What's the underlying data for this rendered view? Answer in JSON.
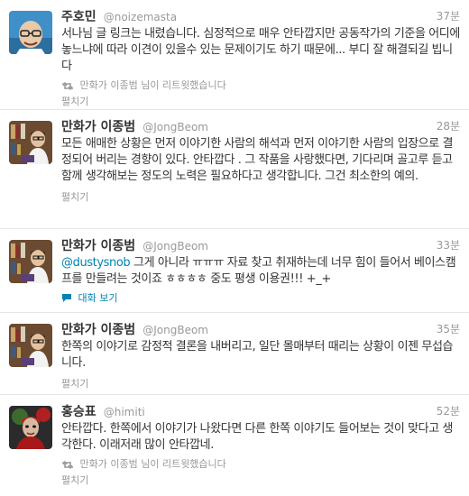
{
  "tweets": [
    {
      "fullname": "주호민",
      "username": "@noizemasta",
      "time": "37분",
      "text": "서나님 글 링크는 내렸습니다. 심정적으로 매우 안타깝지만 공동작가의 기준을 어디에 놓느냐에 따라 이견이 있을수 있는 문제이기도 하기 때문에... 부디 잘 해결되길 빕니다",
      "retweet_note": "만화가 이종범 님이 리트윗했습니다",
      "action": "펼치기",
      "avatar_icon": "avatar-glasses-man-icon"
    },
    {
      "fullname": "만화가 이종범",
      "username": "@JongBeom",
      "time": "28분",
      "text": "모든 애매한 상황은 먼저 이야기한 사람의 해석과 먼저 이야기한 사람의 입장으로 결정되어 버리는 경향이 있다. 안타깝다 . 그 작품을 사랑했다면, 기다리며 골고루 듣고 함께 생각해보는 정도의 노력은 필요하다고 생각합니다. 그건 최소한의 예의.",
      "action": "펼치기",
      "avatar_icon": "avatar-bookshelf-icon"
    },
    {
      "fullname": "만화가 이종범",
      "username": "@JongBeom",
      "time": "33분",
      "mention": "@dustysnob",
      "text": " 그게 아니라 ㅠㅠㅠ 자료 찾고 취재하는데 너무 힘이 들어서 베이스캠프를 만들려는 것이죠 ㅎㅎㅎㅎ 중도 평생 이용권!!! +_+",
      "conversation_label": "대화 보기",
      "avatar_icon": "avatar-bookshelf-icon"
    },
    {
      "fullname": "만화가 이종범",
      "username": "@JongBeom",
      "time": "35분",
      "text": "한쪽의 이야기로 감정적 결론을 내버리고, 일단 몰매부터 때리는 상황이 이젠 무섭습니다.",
      "action": "펼치기",
      "avatar_icon": "avatar-bookshelf-icon"
    },
    {
      "fullname": "홍승표",
      "username": "@himiti",
      "time": "52분",
      "text": "안타깝다. 한쪽에서 이야기가 나왔다면 다른 한쪽 이야기도 들어보는 것이 맞다고 생각한다. 이래저래 많이 안타깝네.",
      "retweet_note": "만화가 이종범 님이 리트윗했습니다",
      "action": "펼치기",
      "avatar_icon": "avatar-red-figure-icon"
    }
  ],
  "colors": {
    "link": "#0084b4",
    "muted": "#999999",
    "text": "#333333",
    "divider": "#e6e6e6"
  }
}
